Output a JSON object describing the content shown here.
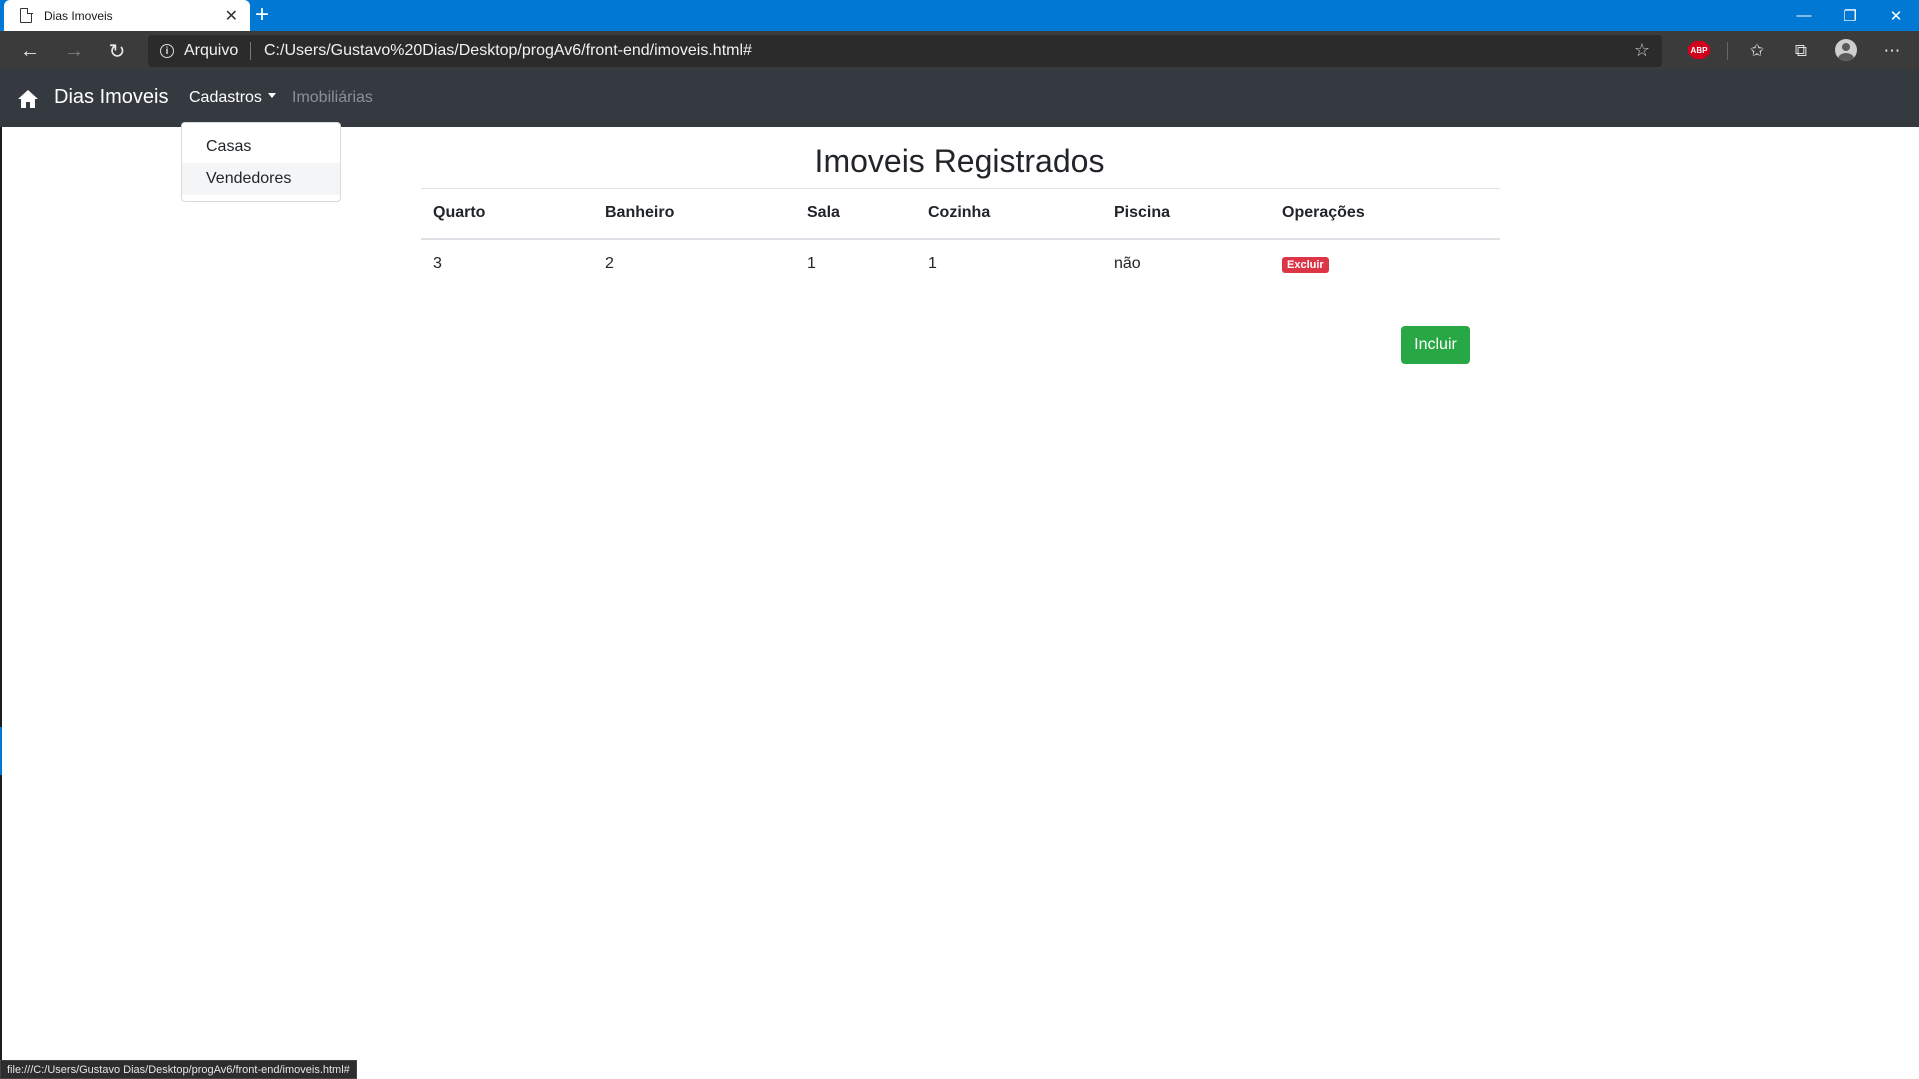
{
  "browser": {
    "tab_title": "Dias Imoveis",
    "new_tab_label": "+",
    "scheme_label": "Arquivo",
    "url": "C:/Users/Gustavo%20Dias/Desktop/progAv6/front-end/imoveis.html#",
    "extension_label": "ABP",
    "status_url": "file:///C:/Users/Gustavo Dias/Desktop/progAv6/front-end/imoveis.html#"
  },
  "navbar": {
    "brand": "Dias Imoveis",
    "items": [
      {
        "label": "Cadastros",
        "active": true
      },
      {
        "label": "Imobiliárias",
        "active": false
      }
    ],
    "dropdown_items": [
      "Casas",
      "Vendedores"
    ]
  },
  "main": {
    "title": "Imoveis Registrados",
    "columns": [
      "Quarto",
      "Banheiro",
      "Sala",
      "Cozinha",
      "Piscina",
      "Operações"
    ],
    "rows": [
      {
        "quarto": "3",
        "banheiro": "2",
        "sala": "1",
        "cozinha": "1",
        "piscina": "não",
        "action": "Excluir"
      }
    ],
    "include_button": "Incluir"
  },
  "colors": {
    "titlebar": "#0078d4",
    "navbar": "#343a40",
    "danger": "#dc3545",
    "success": "#28a745"
  },
  "icons": [
    "page-icon",
    "close-icon",
    "back-arrow-icon",
    "forward-arrow-icon",
    "refresh-icon",
    "info-icon",
    "star-icon",
    "favorites-icon",
    "collections-icon",
    "profile-icon",
    "more-icon",
    "home-icon"
  ]
}
